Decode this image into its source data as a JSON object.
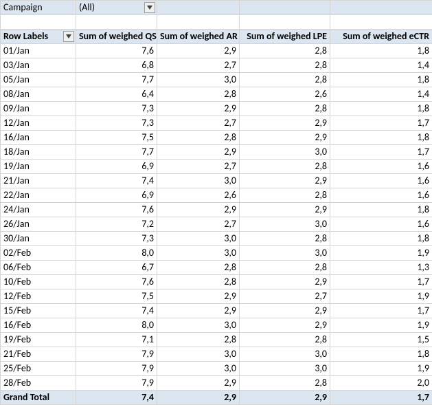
{
  "filter": {
    "field_label": "Campaign",
    "value": "(All)"
  },
  "headers": {
    "row_labels": "Row Labels",
    "col1": "Sum of weighed QS",
    "col2": "Sum of weighed AR",
    "col3": "Sum of weighed LPE",
    "col4": "Sum of weighed eCTR"
  },
  "rows": [
    {
      "label": "01/Jan",
      "qs": "7,6",
      "ar": "2,9",
      "lpe": "2,8",
      "ectr": "1,8"
    },
    {
      "label": "03/Jan",
      "qs": "6,8",
      "ar": "2,7",
      "lpe": "2,8",
      "ectr": "1,4"
    },
    {
      "label": "05/Jan",
      "qs": "7,7",
      "ar": "3,0",
      "lpe": "2,8",
      "ectr": "1,8"
    },
    {
      "label": "08/Jan",
      "qs": "6,4",
      "ar": "2,8",
      "lpe": "2,6",
      "ectr": "1,4"
    },
    {
      "label": "09/Jan",
      "qs": "7,3",
      "ar": "2,9",
      "lpe": "2,8",
      "ectr": "1,8"
    },
    {
      "label": "12/Jan",
      "qs": "7,3",
      "ar": "2,7",
      "lpe": "2,9",
      "ectr": "1,7"
    },
    {
      "label": "16/Jan",
      "qs": "7,5",
      "ar": "2,8",
      "lpe": "2,9",
      "ectr": "1,8"
    },
    {
      "label": "18/Jan",
      "qs": "7,7",
      "ar": "2,9",
      "lpe": "3,0",
      "ectr": "1,7"
    },
    {
      "label": "19/Jan",
      "qs": "6,9",
      "ar": "2,7",
      "lpe": "2,8",
      "ectr": "1,6"
    },
    {
      "label": "21/Jan",
      "qs": "7,4",
      "ar": "3,0",
      "lpe": "2,9",
      "ectr": "1,6"
    },
    {
      "label": "22/Jan",
      "qs": "6,9",
      "ar": "2,6",
      "lpe": "2,8",
      "ectr": "1,6"
    },
    {
      "label": "24/Jan",
      "qs": "7,6",
      "ar": "2,9",
      "lpe": "2,9",
      "ectr": "1,8"
    },
    {
      "label": "26/Jan",
      "qs": "7,2",
      "ar": "2,7",
      "lpe": "3,0",
      "ectr": "1,6"
    },
    {
      "label": "30/Jan",
      "qs": "7,3",
      "ar": "3,0",
      "lpe": "2,8",
      "ectr": "1,8"
    },
    {
      "label": "02/Feb",
      "qs": "8,0",
      "ar": "3,0",
      "lpe": "3,0",
      "ectr": "1,9"
    },
    {
      "label": "06/Feb",
      "qs": "6,7",
      "ar": "2,8",
      "lpe": "2,8",
      "ectr": "1,3"
    },
    {
      "label": "10/Feb",
      "qs": "7,6",
      "ar": "2,8",
      "lpe": "2,9",
      "ectr": "1,7"
    },
    {
      "label": "12/Feb",
      "qs": "7,5",
      "ar": "2,9",
      "lpe": "2,7",
      "ectr": "1,9"
    },
    {
      "label": "15/Feb",
      "qs": "7,4",
      "ar": "2,9",
      "lpe": "2,9",
      "ectr": "1,7"
    },
    {
      "label": "16/Feb",
      "qs": "8,0",
      "ar": "3,0",
      "lpe": "2,9",
      "ectr": "1,9"
    },
    {
      "label": "19/Feb",
      "qs": "7,1",
      "ar": "2,8",
      "lpe": "2,8",
      "ectr": "1,5"
    },
    {
      "label": "21/Feb",
      "qs": "7,9",
      "ar": "3,0",
      "lpe": "3,0",
      "ectr": "1,8"
    },
    {
      "label": "25/Feb",
      "qs": "7,9",
      "ar": "3,0",
      "lpe": "3,0",
      "ectr": "1,9"
    },
    {
      "label": "28/Feb",
      "qs": "7,9",
      "ar": "2,9",
      "lpe": "2,8",
      "ectr": "2,0"
    }
  ],
  "grand_total": {
    "label": "Grand Total",
    "qs": "7,4",
    "ar": "2,9",
    "lpe": "2,9",
    "ectr": "1,7"
  },
  "chart_data": {
    "type": "table",
    "title": "Pivot table of weighed QS / AR / LPE / eCTR by date",
    "columns": [
      "Row Labels",
      "Sum of weighed QS",
      "Sum of weighed AR",
      "Sum of weighed LPE",
      "Sum of weighed eCTR"
    ]
  }
}
